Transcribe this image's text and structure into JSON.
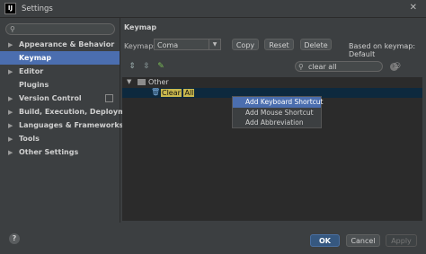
{
  "window": {
    "title": "Settings",
    "app_icon": "IJ"
  },
  "sidebar": {
    "search_placeholder": "",
    "items": [
      {
        "label": "Appearance & Behavior",
        "arrow": "▶"
      },
      {
        "label": "Keymap",
        "arrow": ""
      },
      {
        "label": "Editor",
        "arrow": "▶"
      },
      {
        "label": "Plugins",
        "arrow": ""
      },
      {
        "label": "Version Control",
        "arrow": "▶"
      },
      {
        "label": "Build, Execution, Deployment",
        "arrow": "▶"
      },
      {
        "label": "Languages & Frameworks",
        "arrow": "▶"
      },
      {
        "label": "Tools",
        "arrow": "▶"
      },
      {
        "label": "Other Settings",
        "arrow": "▶"
      }
    ]
  },
  "keymap": {
    "heading": "Keymap",
    "keymaps_label": "Keymaps:",
    "selected_keymap": "Coma",
    "copy_label": "Copy",
    "reset_label": "Reset",
    "delete_label": "Delete",
    "based_on": "Based on keymap: Default",
    "filter_value": "clear all"
  },
  "tree": {
    "group_label": "Other",
    "group_toggle": "▼",
    "action_part1": "Clear",
    "action_part2": "All"
  },
  "context_menu": {
    "items": [
      "Add Keyboard Shortcut",
      "Add Mouse Shortcut",
      "Add Abbreviation"
    ]
  },
  "footer": {
    "help_label": "?",
    "ok_label": "OK",
    "cancel_label": "Cancel",
    "apply_label": "Apply"
  },
  "colors": {
    "background": "#3c3f41",
    "selection": "#4b6eaf",
    "tree_background": "#2b2b2b",
    "search_highlight": "#c9b84e"
  }
}
